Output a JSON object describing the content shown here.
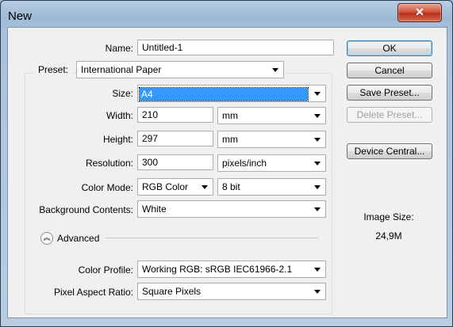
{
  "window": {
    "title": "New",
    "close_glyph": "✕"
  },
  "form": {
    "name_label": "Name:",
    "name_value": "Untitled-1",
    "preset_label": "Preset:",
    "preset_value": "International Paper",
    "size_label": "Size:",
    "size_value": "A4",
    "width_label": "Width:",
    "width_value": "210",
    "width_unit": "mm",
    "height_label": "Height:",
    "height_value": "297",
    "height_unit": "mm",
    "resolution_label": "Resolution:",
    "resolution_value": "300",
    "resolution_unit": "pixels/inch",
    "color_mode_label": "Color Mode:",
    "color_mode_value": "RGB Color",
    "bit_depth_value": "8 bit",
    "background_label": "Background Contents:",
    "background_value": "White",
    "advanced_label": "Advanced",
    "advanced_icon": "collapse-chevrons-icon",
    "color_profile_label": "Color Profile:",
    "color_profile_value": "Working RGB:  sRGB IEC61966-2.1",
    "pixel_aspect_label": "Pixel Aspect Ratio:",
    "pixel_aspect_value": "Square Pixels"
  },
  "buttons": {
    "ok": "OK",
    "cancel": "Cancel",
    "save_preset": "Save Preset...",
    "delete_preset": "Delete Preset...",
    "device_central": "Device Central..."
  },
  "info": {
    "image_size_label": "Image Size:",
    "image_size_value": "24,9M"
  },
  "colors": {
    "selection": "#3399ff",
    "close_button": "#c9452e",
    "dialog_background": "#f0f0f0"
  }
}
